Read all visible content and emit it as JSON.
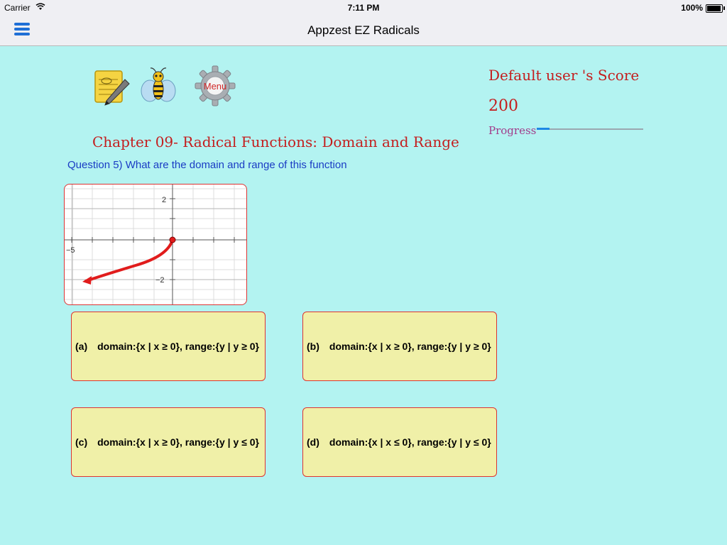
{
  "status_bar": {
    "carrier": "Carrier",
    "time": "7:11 PM",
    "battery": "100%"
  },
  "nav": {
    "title": "Appzest EZ Radicals"
  },
  "toolbar": {
    "notes_icon": "notepad-pencil-icon",
    "bee_icon": "bee-icon",
    "menu_label": "Menu",
    "menu_icon": "gear-icon"
  },
  "score": {
    "title": "Default user 's Score",
    "value": "200",
    "progress_label": "Progress",
    "progress_fraction": 0.12
  },
  "chapter": "Chapter 09- Radical Functions: Domain and Range",
  "question": "Question 5)  What are the domain and range of this function",
  "graph": {
    "tick_labels": {
      "y_top": "2",
      "y_bottom": "−2",
      "x_left": "−5"
    }
  },
  "answers": [
    {
      "letter": "(a)",
      "text": "domain:{x | x ≥ 0}, range:{y | y ≥ 0}"
    },
    {
      "letter": "(b)",
      "text": "domain:{x | x ≥ 0}, range:{y | y ≥ 0}"
    },
    {
      "letter": "(c)",
      "text": "domain:{x | x ≥ 0}, range:{y | y ≤ 0}"
    },
    {
      "letter": "(d)",
      "text": "domain:{x | x ≤ 0}, range:{y | y ≤ 0}"
    }
  ],
  "colors": {
    "background": "#b3f3f1",
    "accent_red": "#c41e1e",
    "question_blue": "#1a3cc4",
    "answer_fill": "#f0f0a8"
  }
}
